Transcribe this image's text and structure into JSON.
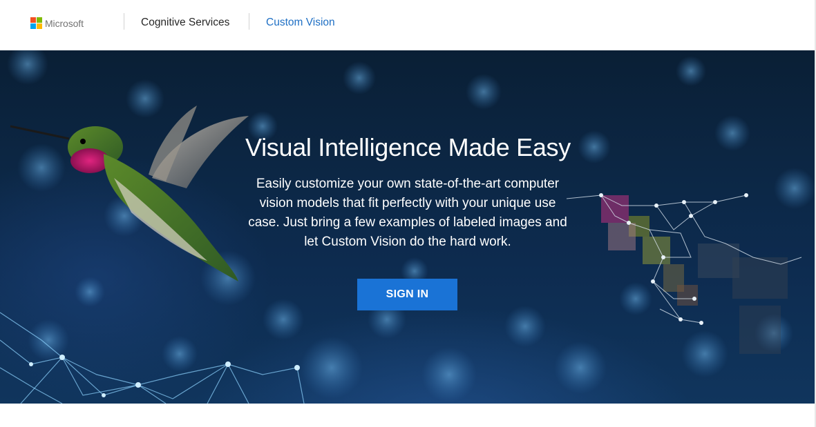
{
  "header": {
    "brand": "Microsoft",
    "nav": [
      {
        "label": "Cognitive Services"
      },
      {
        "label": "Custom Vision"
      }
    ],
    "logo_colors": [
      "#f25022",
      "#7fba00",
      "#00a4ef",
      "#ffb900"
    ],
    "active_link_color": "#1e6fc4"
  },
  "hero": {
    "title": "Visual Intelligence Made Easy",
    "description": "Easily customize your own state-of-the-art computer vision models that fit perfectly with your unique use case. Just bring a few examples of labeled images and let Custom Vision do the hard work.",
    "cta_label": "SIGN IN",
    "cta_color": "#1a73d6",
    "background_image": "hummingbird-network-illustration"
  }
}
